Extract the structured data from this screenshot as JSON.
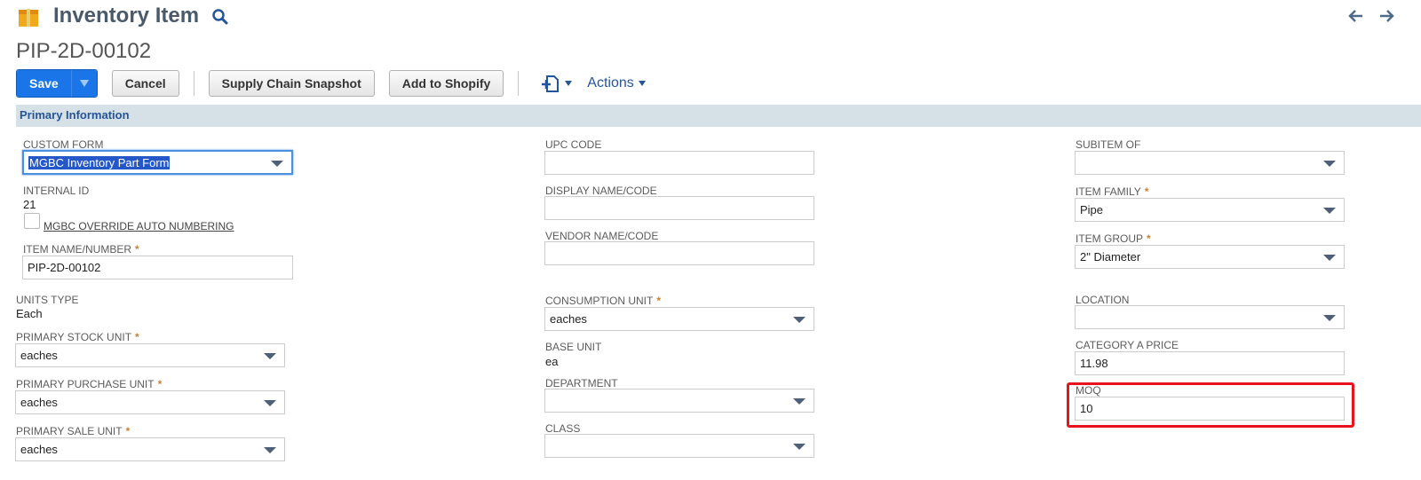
{
  "header": {
    "title": "Inventory Item",
    "record_id": "PIP-2D-00102"
  },
  "toolbar": {
    "save_label": "Save",
    "cancel_label": "Cancel",
    "supply_chain_label": "Supply Chain Snapshot",
    "shopify_label": "Add to Shopify",
    "actions_label": "Actions"
  },
  "section": {
    "title": "Primary Information"
  },
  "fields": {
    "custom_form": {
      "label": "Custom Form",
      "value": "MGBC Inventory Part Form"
    },
    "internal_id": {
      "label": "Internal ID",
      "value": "21"
    },
    "override": {
      "label": "MGBC Override Auto Numbering"
    },
    "item_name": {
      "label": "Item Name/Number",
      "value": "PIP-2D-00102"
    },
    "units_type": {
      "label": "Units Type",
      "value": "Each"
    },
    "primary_stock_unit": {
      "label": "Primary Stock Unit",
      "value": "eaches"
    },
    "primary_purchase_unit": {
      "label": "Primary Purchase Unit",
      "value": "eaches"
    },
    "primary_sale_unit": {
      "label": "Primary Sale Unit",
      "value": "eaches"
    },
    "upc_code": {
      "label": "UPC Code",
      "value": ""
    },
    "display_name": {
      "label": "Display Name/Code",
      "value": ""
    },
    "vendor_name": {
      "label": "Vendor Name/Code",
      "value": ""
    },
    "consumption_unit": {
      "label": "Consumption Unit",
      "value": "eaches"
    },
    "base_unit": {
      "label": "Base Unit",
      "value": "ea"
    },
    "department": {
      "label": "Department",
      "value": ""
    },
    "class": {
      "label": "Class",
      "value": ""
    },
    "subitem_of": {
      "label": "Subitem of",
      "value": ""
    },
    "item_family": {
      "label": "Item Family",
      "value": "Pipe"
    },
    "item_group": {
      "label": "Item Group",
      "value": "2\" Diameter"
    },
    "location": {
      "label": "Location",
      "value": ""
    },
    "category_a_price": {
      "label": "Category A Price",
      "value": "11.98"
    },
    "moq": {
      "label": "MOQ",
      "value": "10"
    }
  },
  "colors": {
    "accent": "#1a76e8",
    "link": "#255599",
    "section_bar": "#d5e0e7",
    "required": "#c68232",
    "highlight_box": "#e8131f"
  }
}
